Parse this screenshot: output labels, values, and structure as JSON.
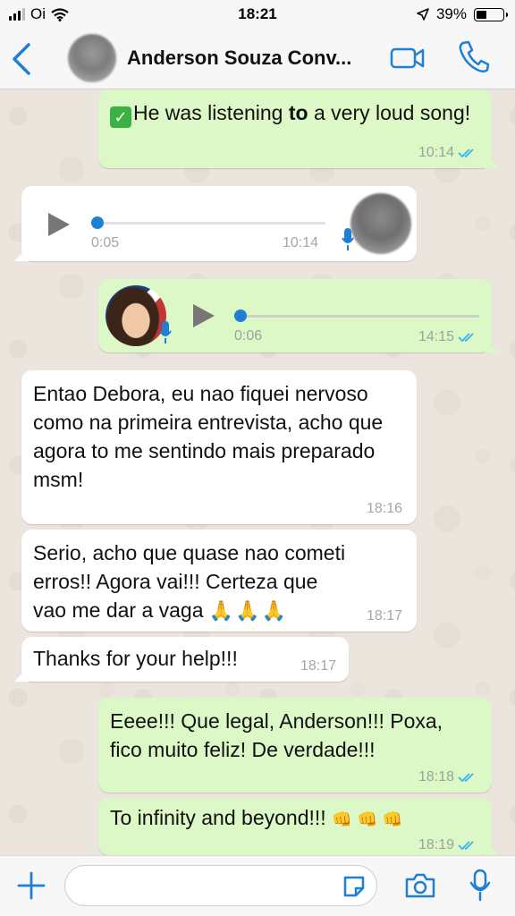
{
  "status_bar": {
    "carrier": "Oi",
    "time": "18:21",
    "battery": "39%"
  },
  "header": {
    "contact_name": "Anderson Souza Conv..."
  },
  "colors": {
    "accent": "#1f7fd3",
    "bubble_out": "#dcf8c6",
    "bubble_in": "#ffffff"
  },
  "messages": [
    {
      "dir": "out",
      "text_pre": "He was listening ",
      "text_bold": "to",
      "text_post": " a very loud song!",
      "time": "10:14"
    },
    {
      "dir": "in",
      "type": "voice",
      "duration": "0:05",
      "time": "10:14"
    },
    {
      "dir": "out",
      "type": "voice",
      "duration": "0:06",
      "time": "14:15"
    },
    {
      "dir": "in",
      "text": "Entao Debora, eu nao fiquei nervoso como na primeira entrevista, acho que agora to me sentindo mais preparado msm!",
      "time": "18:16"
    },
    {
      "dir": "in",
      "text": "Serio, acho que quase nao cometi erros!! Agora vai!!! Certeza que vao me dar a vaga",
      "emoji": "🙏🙏🙏",
      "time": "18:17"
    },
    {
      "dir": "in",
      "text": "Thanks for your help!!!",
      "time": "18:17"
    },
    {
      "dir": "out",
      "text": "Eeee!!! Que legal, Anderson!!! Poxa, fico muito feliz! De verdade!!!",
      "time": "18:18"
    },
    {
      "dir": "out",
      "text": "To infinity and beyond!!!",
      "emoji": "👊👊👊",
      "time": "18:19"
    }
  ],
  "icons": [
    "back-chevron-icon",
    "video-call-icon",
    "phone-icon",
    "play-icon",
    "mic-icon",
    "plus-icon",
    "sticker-icon",
    "camera-icon",
    "read-ticks-icon"
  ]
}
